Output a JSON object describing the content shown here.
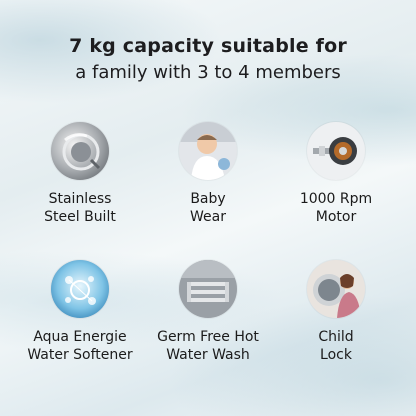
{
  "header": {
    "line1": "7 kg capacity suitable for",
    "line2": "a family with 3 to 4 members"
  },
  "features": [
    {
      "icon": "stainless-drum-icon",
      "line1": "Stainless",
      "line2": "Steel Built"
    },
    {
      "icon": "baby-icon",
      "line1": "Baby",
      "line2": "Wear"
    },
    {
      "icon": "motor-icon",
      "line1": "1000 Rpm",
      "line2": "Motor"
    },
    {
      "icon": "water-drop-icon",
      "line1": "Aqua Energie",
      "line2": "Water Softener"
    },
    {
      "icon": "heating-element-icon",
      "line1": "Germ Free Hot",
      "line2": "Water Wash"
    },
    {
      "icon": "child-lock-icon",
      "line1": "Child",
      "line2": "Lock"
    }
  ]
}
